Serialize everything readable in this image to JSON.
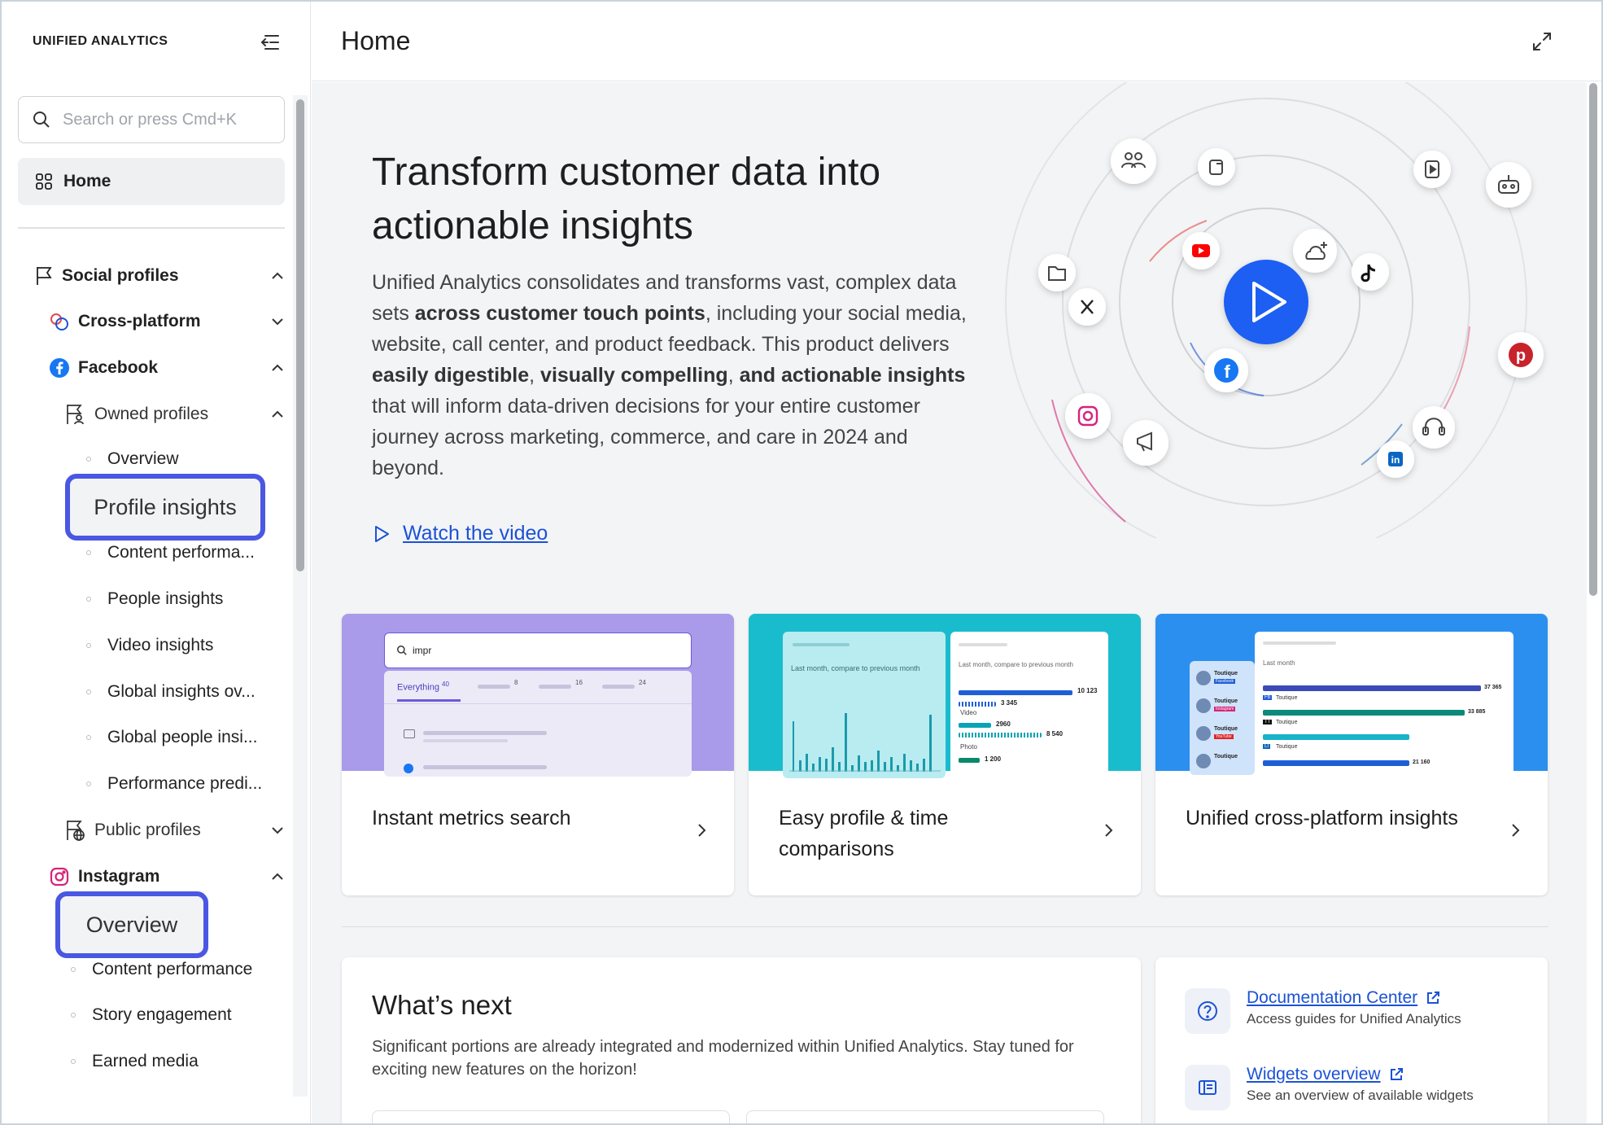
{
  "app": {
    "brand": "UNIFIED ANALYTICS"
  },
  "sidebar": {
    "search_placeholder": "Search or press Cmd+K",
    "home_label": "Home",
    "social_profiles": "Social profiles",
    "cross_platform": "Cross-platform",
    "facebook": "Facebook",
    "owned_profiles": "Owned profiles",
    "facebook_items": [
      "Overview",
      "Profile insights",
      "Content performa...",
      "People insights",
      "Video insights",
      "Global insights ov...",
      "Global people insi...",
      "Performance predi..."
    ],
    "public_profiles": "Public profiles",
    "instagram": "Instagram",
    "instagram_items": [
      "Overview",
      "Content performance",
      "Story engagement",
      "Earned media"
    ]
  },
  "header": {
    "title": "Home"
  },
  "hero": {
    "title": "Transform customer data into actionable insights",
    "body_1": "Unified Analytics consolidates and transforms vast, complex data sets ",
    "body_b1": "across customer touch points",
    "body_2": ", including your social media, website, call center, and product feedback. This product delivers ",
    "body_b2": "easily digestible",
    "body_3": ", ",
    "body_b3": "visually compelling",
    "body_4": ", ",
    "body_b4": "and actionable insights",
    "body_5": " that will inform data-driven decisions for your entire customer journey across marketing, commerce, and care in 2024 and beyond.",
    "watch_label": "Watch the video"
  },
  "cards": [
    {
      "title": "Instant metrics search",
      "preview": {
        "search_text": "impr",
        "tab_label": "Everything",
        "counts": [
          "40",
          "8",
          "16",
          "24"
        ]
      }
    },
    {
      "title": "Easy profile & time comparisons",
      "preview": {
        "subtitle": "Last month, compare to previous month",
        "values": [
          "10 123",
          "3 345",
          "2960",
          "8 540",
          "1 200"
        ],
        "labels": [
          "Video",
          "Photo"
        ]
      }
    },
    {
      "title": "Unified cross-platform insights",
      "preview": {
        "subtitle": "Last month",
        "profile": "Toutique",
        "badges": [
          "Fb",
          "TT",
          "LI"
        ],
        "source_tags": [
          "Facebook",
          "Instagram",
          "YouTube"
        ],
        "values": [
          "37 365",
          "33 885",
          "21 160"
        ]
      }
    }
  ],
  "whats_next": {
    "title": "What’s next",
    "body": "Significant portions are already integrated and modernized within Unified Analytics. Stay tuned for exciting new features on the horizon!"
  },
  "resources": [
    {
      "title": "Documentation Center",
      "subtitle": "Access guides for Unified Analytics"
    },
    {
      "title": "Widgets overview",
      "subtitle": "See an overview of available widgets"
    }
  ],
  "colors": {
    "accent": "#1b52d6",
    "highlight": "#4a57e3",
    "card1": "#a99aea",
    "card2": "#19bccd",
    "card3": "#2b8ff0"
  }
}
